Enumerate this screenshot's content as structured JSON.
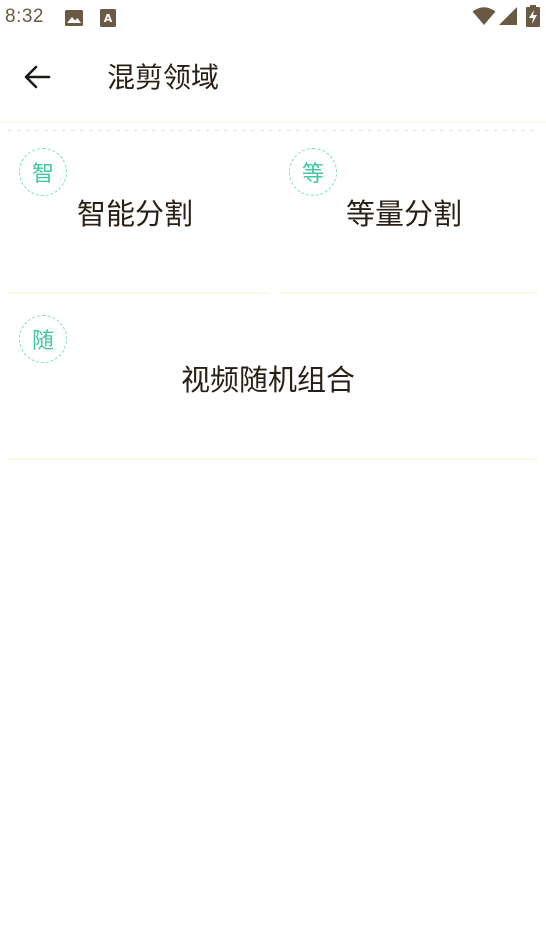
{
  "status_bar": {
    "time": "8:32",
    "left_icons": [
      "image-icon",
      "text-a-icon"
    ],
    "right_icons": [
      "wifi-icon",
      "signal-icon",
      "battery-charging-icon"
    ]
  },
  "app_bar": {
    "back_icon": "arrow-left-icon",
    "title": "混剪领域"
  },
  "cards": [
    {
      "badge": "智",
      "label": "智能分割"
    },
    {
      "badge": "等",
      "label": "等量分割"
    },
    {
      "badge": "随",
      "label": "视频随机组合"
    }
  ],
  "colors": {
    "accent": "#3ec9a0",
    "badge_border": "#7fe0b8",
    "text": "#2a1f14",
    "status_text": "#6b5a43",
    "divider": "#f7fbe6"
  }
}
